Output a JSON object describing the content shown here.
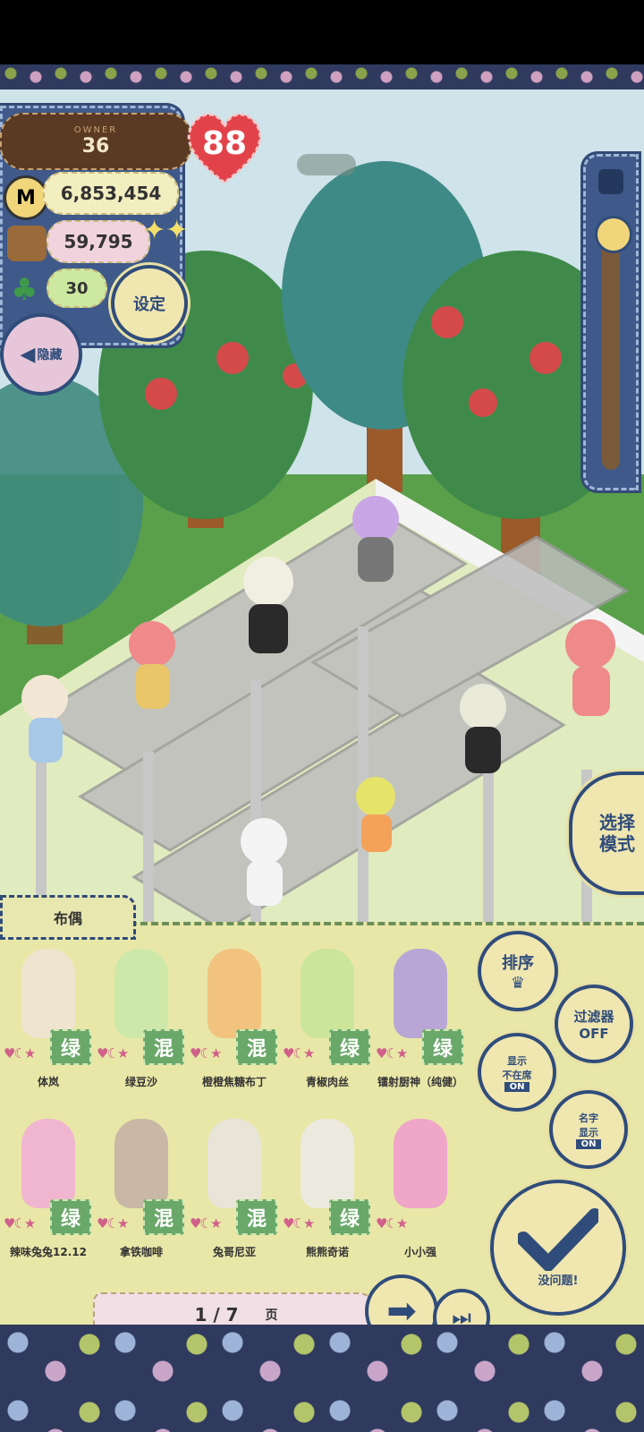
{
  "hud": {
    "owner_label": "OWNER",
    "owner_level": "36",
    "heart_value": "88",
    "coins": "6,853,454",
    "food": "59,795",
    "clover": "30",
    "settings_label": "设定",
    "hide_label": "隐藏",
    "mode_label_line1": "选择",
    "mode_label_line2": "模式"
  },
  "panel": {
    "category_tab": "布偶",
    "sort_label": "排序",
    "filter_label": "过滤器",
    "filter_state": "OFF",
    "show_absent_line1": "显示",
    "show_absent_line2": "不在席",
    "show_absent_state": "ON",
    "show_name_line1": "名字",
    "show_name_line2": "显示",
    "show_name_state": "ON",
    "ok_label": "没问题!",
    "page_current": "1",
    "page_total": "7",
    "page_text": "1 / 7",
    "page_unit": "页"
  },
  "dolls": [
    {
      "name": "体岚",
      "tag": "绿",
      "color": "#efe4cf"
    },
    {
      "name": "绿豆沙",
      "tag": "混",
      "color": "#cde8a9"
    },
    {
      "name": "橙橙焦糖布丁",
      "tag": "混",
      "color": "#f2c27f"
    },
    {
      "name": "青椒肉丝",
      "tag": "绿",
      "color": "#cbe59a"
    },
    {
      "name": "镭射厨神（纯健）",
      "tag": "绿",
      "color": "#b9a6d6"
    },
    {
      "name": "辣味兔兔12.12",
      "tag": "绿",
      "color": "#f1b6cf"
    },
    {
      "name": "拿铁咖啡",
      "tag": "混",
      "color": "#c9b8a6"
    },
    {
      "name": "兔哥尼亚",
      "tag": "混",
      "color": "#e8e4d8"
    },
    {
      "name": "熊熊奇诺",
      "tag": "绿",
      "color": "#eceadf"
    },
    {
      "name": "小小强",
      "tag": "",
      "color": "#f0a6c8"
    }
  ]
}
